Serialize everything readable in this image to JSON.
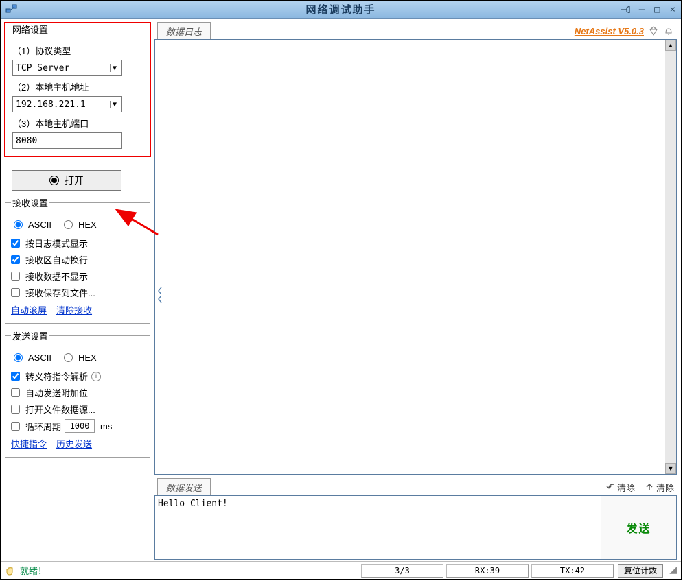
{
  "titlebar": {
    "title": "网络调试助手",
    "minimize": "—",
    "maximize": "□",
    "close": "×"
  },
  "network_settings": {
    "legend": "网络设置",
    "protocol_label": "（1）协议类型",
    "protocol_value": "TCP Server",
    "host_label": "（2）本地主机地址",
    "host_value": "192.168.221.1",
    "port_label": "（3）本地主机端口",
    "port_value": "8080",
    "open_button": "打开"
  },
  "recv_settings": {
    "legend": "接收设置",
    "ascii": "ASCII",
    "hex": "HEX",
    "log_mode": "按日志模式显示",
    "auto_wrap": "接收区自动换行",
    "hide_recv": "接收数据不显示",
    "save_to_file": "接收保存到文件...",
    "auto_scroll": "自动滚屏",
    "clear_recv": "清除接收"
  },
  "send_settings": {
    "legend": "发送设置",
    "ascii": "ASCII",
    "hex": "HEX",
    "escape_parse": "转义符指令解析",
    "auto_append": "自动发送附加位",
    "open_file_src": "打开文件数据源...",
    "loop_send": "循环周期",
    "loop_value": "1000",
    "loop_unit": "ms",
    "quick_cmd": "快捷指令",
    "history_send": "历史发送"
  },
  "log_panel": {
    "title": "数据日志",
    "brand": "NetAssist V5.0.3"
  },
  "send_panel": {
    "title": "数据发送",
    "clear1": "清除",
    "clear2": "清除",
    "input_value": "Hello Client!",
    "send_button": "发送"
  },
  "statusbar": {
    "ready": "就绪！",
    "counter": "3/3",
    "rx": "RX:39",
    "tx": "TX:42",
    "reset": "复位计数"
  }
}
